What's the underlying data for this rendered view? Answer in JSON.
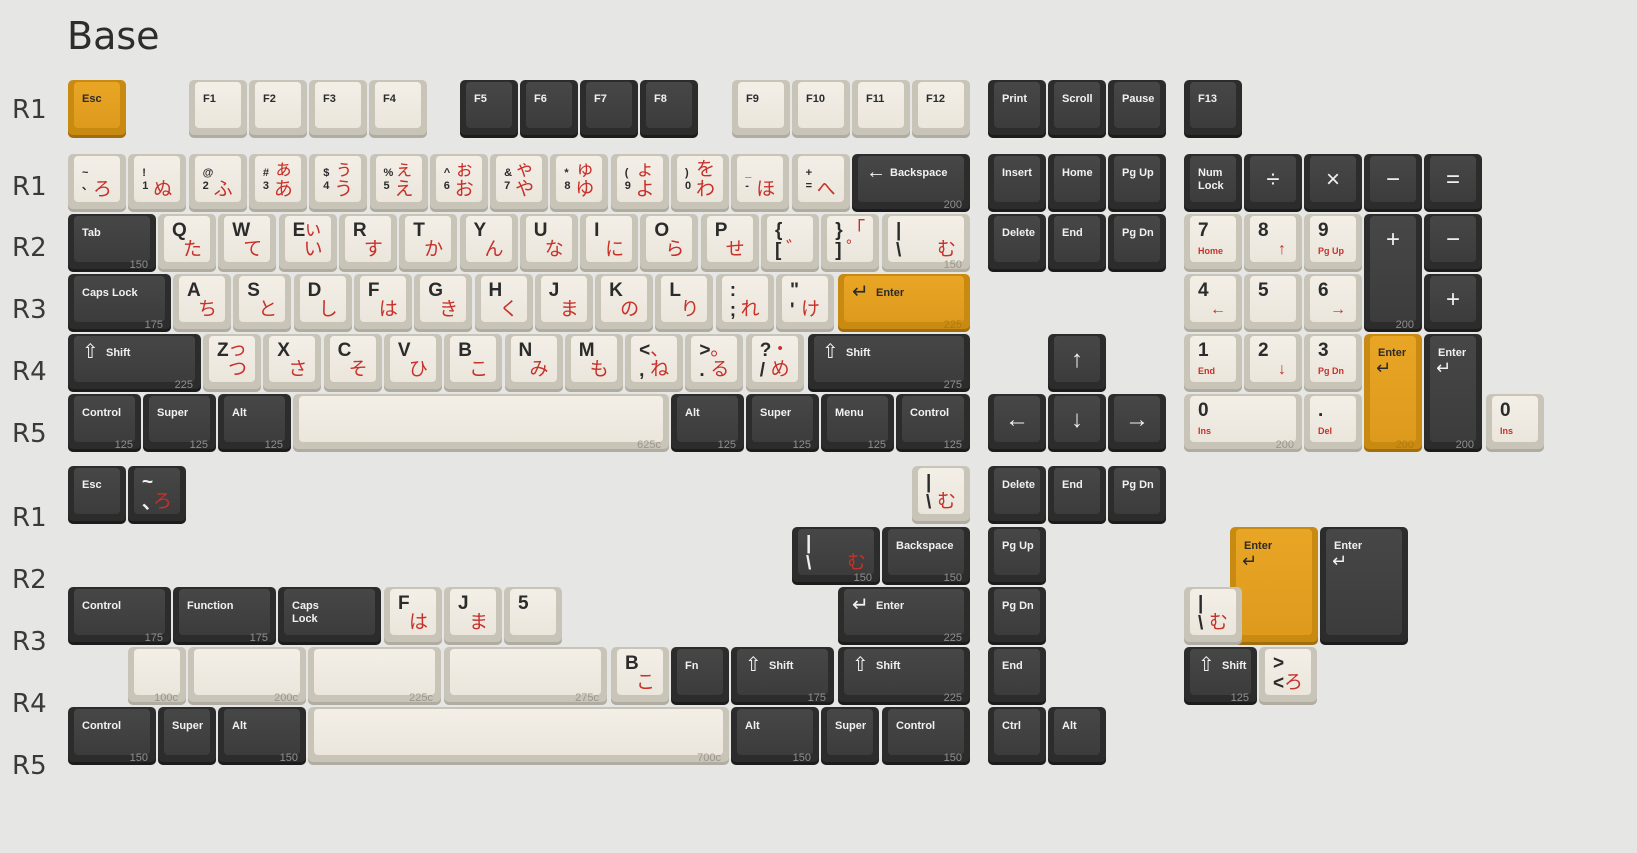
{
  "title": "Base",
  "row_labels": [
    "R1",
    "R1",
    "R2",
    "R3",
    "R4",
    "R5",
    "R1",
    "R2",
    "R3",
    "R4",
    "R5"
  ],
  "colors": {
    "background": "#e6e6e4",
    "dark": "#3b3c3b",
    "light": "#ece7dd",
    "accent": "#e0a020",
    "legend_red": "#c8302a"
  },
  "keys": {
    "esc": "Esc",
    "f1": "F1",
    "f2": "F2",
    "f3": "F3",
    "f4": "F4",
    "f5": "F5",
    "f6": "F6",
    "f7": "F7",
    "f8": "F8",
    "f9": "F9",
    "f10": "F10",
    "f11": "F11",
    "f12": "F12",
    "print": "Print",
    "scroll": "Scroll",
    "pause": "Pause",
    "f13": "F13",
    "num_row": [
      {
        "top": "~\n、",
        "kana": "ろ"
      },
      {
        "top": "!\n1",
        "kana": "ぬ"
      },
      {
        "top": "@\n2",
        "kana": "ふ"
      },
      {
        "top": "#\n3",
        "kana": "ぁ\nあ"
      },
      {
        "top": "$\n4",
        "kana": "ぅ\nう"
      },
      {
        "top": "%\n5",
        "kana": "ぇ\nえ"
      },
      {
        "top": "^\n6",
        "kana": "ぉ\nお"
      },
      {
        "top": "&\n7",
        "kana": "ゃ\nや"
      },
      {
        "top": "*\n8",
        "kana": "ゅ\nゆ"
      },
      {
        "top": "(\n9",
        "kana": "ょ\nよ"
      },
      {
        "top": ")\n0",
        "kana": "を\nわ"
      },
      {
        "top": "_\n-",
        "kana": "ほ"
      },
      {
        "top": "+\n=",
        "kana": "へ"
      }
    ],
    "backspace": "Backspace",
    "backspace_size": "200",
    "insert": "Insert",
    "home": "Home",
    "pg_up": "Pg Up",
    "num_lock": "Num\nLock",
    "divide": "÷",
    "multiply": "×",
    "minus": "−",
    "equals": "=",
    "tab": "Tab",
    "tab_size": "150",
    "qrow": [
      {
        "letter": "Q",
        "kana": "た"
      },
      {
        "letter": "W",
        "kana": "て"
      },
      {
        "letter": "E",
        "kana": "ぃ\nい"
      },
      {
        "letter": "R",
        "kana": "す"
      },
      {
        "letter": "T",
        "kana": "か"
      },
      {
        "letter": "Y",
        "kana": "ん"
      },
      {
        "letter": "U",
        "kana": "な"
      },
      {
        "letter": "I",
        "kana": "に"
      },
      {
        "letter": "O",
        "kana": "ら"
      },
      {
        "letter": "P",
        "kana": "せ"
      },
      {
        "letter": "{\n[",
        "kana": "゛"
      },
      {
        "letter": "}\n]",
        "kana": "「\n゜"
      }
    ],
    "backslash_top": "|\n\\",
    "backslash_kana": "む",
    "backslash_size": "150",
    "delete": "Delete",
    "end": "End",
    "pg_dn": "Pg Dn",
    "num7": "7",
    "num7_sub": "Home",
    "num8": "8",
    "num8_sub": "↑",
    "num9": "9",
    "num9_sub": "Pg Up",
    "num_plus": "+",
    "num_minus": "−",
    "caps_lock": "Caps Lock",
    "caps_size": "175",
    "arow": [
      {
        "letter": "A",
        "kana": "ち"
      },
      {
        "letter": "S",
        "kana": "と"
      },
      {
        "letter": "D",
        "kana": "し"
      },
      {
        "letter": "F",
        "kana": "は"
      },
      {
        "letter": "G",
        "kana": "き"
      },
      {
        "letter": "H",
        "kana": "く"
      },
      {
        "letter": "J",
        "kana": "ま"
      },
      {
        "letter": "K",
        "kana": "の"
      },
      {
        "letter": "L",
        "kana": "り"
      },
      {
        "letter": ":\n;",
        "kana": "れ"
      },
      {
        "letter": "\"\n'",
        "kana": "け"
      }
    ],
    "enter": "Enter",
    "enter_size": "225",
    "num4": "4",
    "num4_sub": "←",
    "num5": "5",
    "num6": "6",
    "num6_sub": "→",
    "num_plus2": "+",
    "shift": "Shift",
    "lshift_size": "225",
    "zrow": [
      {
        "letter": "Z",
        "kana": "っ\nつ"
      },
      {
        "letter": "X",
        "kana": "さ"
      },
      {
        "letter": "C",
        "kana": "そ"
      },
      {
        "letter": "V",
        "kana": "ひ"
      },
      {
        "letter": "B",
        "kana": "こ"
      },
      {
        "letter": "N",
        "kana": "み"
      },
      {
        "letter": "M",
        "kana": "も"
      },
      {
        "letter": "<\n,",
        "kana": "、\nね"
      },
      {
        "letter": ">\n.",
        "kana": "。\nる"
      },
      {
        "letter": "?\n/",
        "kana": "・\nめ"
      }
    ],
    "rshift_size": "275",
    "up_arrow": "↑",
    "num1": "1",
    "num1_sub": "End",
    "num2": "2",
    "num2_sub": "↓",
    "num3": "3",
    "num3_sub": "Pg Dn",
    "num_enter_size": "200",
    "control": "Control",
    "super": "Super",
    "alt": "Alt",
    "menu": "Menu",
    "mod_size": "125",
    "space_size": "625c",
    "left_arrow": "←",
    "down_arrow": "↓",
    "right_arrow": "→",
    "num0": "0",
    "num0_sub": "Ins",
    "num0_size": "200",
    "num_dot": ".",
    "num_dot_sub": "Del",
    "num0_small": "0",
    "num0_small_sub": "Ins",
    "grave_alt_top": "~\n、",
    "grave_alt_kana": "ろ",
    "bs_small_top": "|\n\\",
    "bs_small_kana": "む",
    "bs_wide_top": "|\n\\",
    "bs_wide_kana": "む",
    "bs_wide_size": "150",
    "backspace_150": "Backspace",
    "backspace_150_size": "150",
    "pg_up_alt": "Pg Up",
    "pg_dn_alt": "Pg Dn",
    "ctrl_175": "Control",
    "ctrl_175_size": "175",
    "function": "Function",
    "function_size": "175",
    "caps_lock_2": "Caps\nLock",
    "f_key": "F",
    "f_kana": "は",
    "j_key": "J",
    "j_kana": "ま",
    "five": "5",
    "enter_225": "Enter",
    "enter_225_size": "225",
    "iso_enter_a": "Enter",
    "iso_enter_b": "Enter",
    "bs_iso_top": "|\n\\",
    "bs_iso_kana": "む",
    "sp100": "100c",
    "sp200": "200c",
    "sp225": "225c",
    "sp275": "275c",
    "b_key": "B",
    "b_kana": "こ",
    "fn": "Fn",
    "shift_175_size": "175",
    "shift_225_size": "225",
    "end_alt": "End",
    "shift_125_size": "125",
    "iso_lt_top": ">\n<",
    "iso_lt_kana": "ろ",
    "mod_150_size": "150",
    "space_700": "700c",
    "ctrl_short": "Ctrl",
    "alt_short": "Alt"
  }
}
